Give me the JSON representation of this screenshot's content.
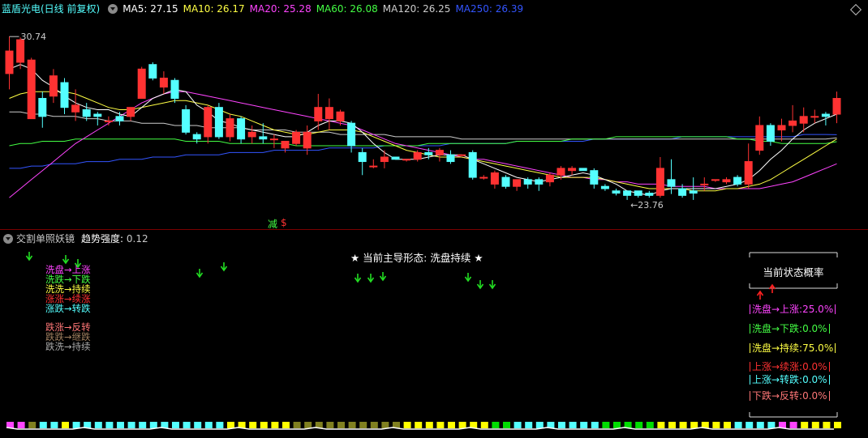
{
  "header": {
    "stock_title": "蓝盾光电(日线 前复权)",
    "ma_items": [
      {
        "label": "MA5: 27.15",
        "color": "#ffffff"
      },
      {
        "label": "MA10: 26.17",
        "color": "#ffff44"
      },
      {
        "label": "MA20: 25.28",
        "color": "#ff44ff"
      },
      {
        "label": "MA60: 26.08",
        "color": "#44ff44"
      },
      {
        "label": "MA120: 26.25",
        "color": "#cccccc"
      },
      {
        "label": "MA250: 26.39",
        "color": "#3355ff"
      }
    ]
  },
  "chart_data": {
    "type": "candlestick",
    "max_label": "30.74",
    "min_label": "23.76",
    "ylim": [
      22.6,
      31.5
    ],
    "candles": [
      [
        29.1,
        30.1,
        28.4,
        30.74
      ],
      [
        29.6,
        30.6,
        29.3,
        30.7
      ],
      [
        27.1,
        29.7,
        27.1,
        29.8
      ],
      [
        28.0,
        27.2,
        26.7,
        28.3
      ],
      [
        28.1,
        29.0,
        27.8,
        29.3
      ],
      [
        28.7,
        27.6,
        27.3,
        28.9
      ],
      [
        27.4,
        27.7,
        27.0,
        28.4
      ],
      [
        27.5,
        27.2,
        27.0,
        27.8
      ],
      [
        27.3,
        27.2,
        26.8,
        27.4
      ],
      [
        27.0,
        27.0,
        26.8,
        27.2
      ],
      [
        27.2,
        27.0,
        26.8,
        27.4
      ],
      [
        27.2,
        27.6,
        27.0,
        27.6
      ],
      [
        28.0,
        29.3,
        28.0,
        29.4
      ],
      [
        29.5,
        28.9,
        28.8,
        29.6
      ],
      [
        28.5,
        28.9,
        28.2,
        29.2
      ],
      [
        28.8,
        28.0,
        27.8,
        28.9
      ],
      [
        27.5,
        26.5,
        26.4,
        27.7
      ],
      [
        26.4,
        26.2,
        26.0,
        26.5
      ],
      [
        26.3,
        27.6,
        26.0,
        27.7
      ],
      [
        27.6,
        26.3,
        26.2,
        27.8
      ],
      [
        26.3,
        27.1,
        26.1,
        27.3
      ],
      [
        27.1,
        26.2,
        26.0,
        27.2
      ],
      [
        26.3,
        26.5,
        26.0,
        26.8
      ],
      [
        26.3,
        26.2,
        26.0,
        26.9
      ],
      [
        26.2,
        26.2,
        25.8,
        26.4
      ],
      [
        25.8,
        26.1,
        25.6,
        26.1
      ],
      [
        26.0,
        26.5,
        25.9,
        26.6
      ],
      [
        25.8,
        26.5,
        25.5,
        26.8
      ],
      [
        27.0,
        27.6,
        26.6,
        28.2
      ],
      [
        27.1,
        27.6,
        26.6,
        28.0
      ],
      [
        27.0,
        27.4,
        26.8,
        27.5
      ],
      [
        26.9,
        25.9,
        25.6,
        27.0
      ],
      [
        25.6,
        25.2,
        24.6,
        25.8
      ],
      [
        25.0,
        25.0,
        24.9,
        25.3
      ],
      [
        25.2,
        25.4,
        24.9,
        25.7
      ],
      [
        25.4,
        25.3,
        25.3,
        25.4
      ],
      [
        25.3,
        25.3,
        25.2,
        25.3
      ],
      [
        25.3,
        25.6,
        25.2,
        25.7
      ],
      [
        25.6,
        25.5,
        25.3,
        25.8
      ],
      [
        25.5,
        25.7,
        25.2,
        25.8
      ],
      [
        25.5,
        25.2,
        25.1,
        25.7
      ],
      [
        25.5,
        25.5,
        25.5,
        25.5
      ],
      [
        25.6,
        24.5,
        24.4,
        25.7
      ],
      [
        24.5,
        24.5,
        24.4,
        24.6
      ],
      [
        24.2,
        24.7,
        24.0,
        24.8
      ],
      [
        24.5,
        24.1,
        24.0,
        24.6
      ],
      [
        24.1,
        24.4,
        23.9,
        24.4
      ],
      [
        24.4,
        24.2,
        24.0,
        24.5
      ],
      [
        24.4,
        24.2,
        23.9,
        24.5
      ],
      [
        24.3,
        24.6,
        24.1,
        24.7
      ],
      [
        24.6,
        24.9,
        24.4,
        25.0
      ],
      [
        24.8,
        24.9,
        24.6,
        25.0
      ],
      [
        24.9,
        24.8,
        24.8,
        24.9
      ],
      [
        24.8,
        24.2,
        24.0,
        24.9
      ],
      [
        24.1,
        24.0,
        23.9,
        24.2
      ],
      [
        23.9,
        23.8,
        23.7,
        24.0
      ],
      [
        23.9,
        23.7,
        23.5,
        23.9
      ],
      [
        23.9,
        23.7,
        23.6,
        23.9
      ],
      [
        23.8,
        23.7,
        23.6,
        23.9
      ],
      [
        23.7,
        24.9,
        23.6,
        25.4
      ],
      [
        24.4,
        24.1,
        23.76,
        25.3
      ],
      [
        24.0,
        23.7,
        23.6,
        24.2
      ],
      [
        23.9,
        23.8,
        23.5,
        24.5
      ],
      [
        24.2,
        24.2,
        23.9,
        24.5
      ],
      [
        24.4,
        24.4,
        24.3,
        24.4
      ],
      [
        24.3,
        24.4,
        24.2,
        24.5
      ],
      [
        24.5,
        24.2,
        24.1,
        24.6
      ],
      [
        24.2,
        25.2,
        24.0,
        26.0
      ],
      [
        25.7,
        26.8,
        25.5,
        27.2
      ],
      [
        26.8,
        26.1,
        25.9,
        26.9
      ],
      [
        26.6,
        26.8,
        26.1,
        27.1
      ],
      [
        26.8,
        27.0,
        26.5,
        27.7
      ],
      [
        26.9,
        27.2,
        26.5,
        27.6
      ],
      [
        27.2,
        27.2,
        26.9,
        27.5
      ],
      [
        27.3,
        27.2,
        26.8,
        27.4
      ],
      [
        27.3,
        28.0,
        26.9,
        28.3
      ]
    ],
    "ma_lines": {
      "MA5": [
        29.3,
        29.5,
        29.3,
        28.8,
        28.5,
        28.1,
        27.8,
        27.6,
        27.5,
        27.5,
        27.3,
        27.2,
        27.6,
        28.0,
        28.2,
        28.4,
        28.3,
        27.7,
        27.4,
        27.0,
        26.9,
        26.7,
        26.6,
        26.5,
        26.4,
        26.3,
        26.3,
        26.5,
        26.8,
        27.0,
        27.0,
        26.9,
        26.5,
        26.0,
        25.6,
        25.3,
        25.3,
        25.3,
        25.4,
        25.5,
        25.5,
        25.5,
        25.3,
        25.1,
        24.9,
        24.7,
        24.5,
        24.4,
        24.3,
        24.4,
        24.5,
        24.6,
        24.7,
        24.6,
        24.4,
        24.2,
        23.9,
        23.8,
        23.7,
        23.9,
        24.0,
        24.0,
        24.0,
        24.0,
        24.0,
        24.1,
        24.2,
        24.4,
        24.8,
        25.3,
        25.7,
        26.2,
        26.6,
        26.9,
        27.1,
        27.3
      ],
      "MA10": [
        28.0,
        28.2,
        28.3,
        28.3,
        28.3,
        28.3,
        28.2,
        28.0,
        27.8,
        27.6,
        27.5,
        27.5,
        27.6,
        27.7,
        27.8,
        27.9,
        27.9,
        27.8,
        27.7,
        27.5,
        27.3,
        27.2,
        27.0,
        26.8,
        26.6,
        26.5,
        26.4,
        26.4,
        26.5,
        26.6,
        26.6,
        26.6,
        26.5,
        26.3,
        26.1,
        25.9,
        25.7,
        25.6,
        25.5,
        25.4,
        25.4,
        25.4,
        25.3,
        25.2,
        25.1,
        25.0,
        24.9,
        24.8,
        24.7,
        24.6,
        24.5,
        24.5,
        24.5,
        24.5,
        24.4,
        24.3,
        24.2,
        24.1,
        24.0,
        24.0,
        24.0,
        24.0,
        23.9,
        23.9,
        23.9,
        24.0,
        24.0,
        24.1,
        24.2,
        24.4,
        24.7,
        25.0,
        25.3,
        25.6,
        25.9,
        26.2
      ],
      "MA20": [
        23.6,
        24.0,
        24.4,
        24.8,
        25.2,
        25.6,
        26.0,
        26.3,
        26.6,
        26.9,
        27.2,
        27.5,
        27.8,
        28.0,
        28.2,
        28.3,
        28.3,
        28.2,
        28.1,
        28.0,
        27.9,
        27.8,
        27.7,
        27.6,
        27.5,
        27.4,
        27.3,
        27.2,
        27.1,
        27.0,
        26.9,
        26.8,
        26.6,
        26.4,
        26.2,
        26.0,
        25.9,
        25.8,
        25.7,
        25.6,
        25.5,
        25.4,
        25.3,
        25.3,
        25.2,
        25.1,
        25.0,
        24.9,
        24.8,
        24.7,
        24.6,
        24.5,
        24.5,
        24.4,
        24.4,
        24.3,
        24.3,
        24.2,
        24.2,
        24.2,
        24.1,
        24.1,
        24.1,
        24.1,
        24.0,
        24.0,
        24.0,
        24.0,
        24.0,
        24.1,
        24.2,
        24.3,
        24.5,
        24.7,
        24.9,
        25.1
      ],
      "MA60": [
        25.9,
        26.0,
        26.0,
        26.1,
        26.1,
        26.1,
        26.2,
        26.2,
        26.2,
        26.2,
        26.2,
        26.2,
        26.2,
        26.2,
        26.2,
        26.2,
        26.1,
        26.1,
        26.1,
        26.1,
        26.0,
        26.0,
        26.0,
        26.0,
        26.0,
        26.0,
        25.9,
        25.9,
        25.9,
        25.9,
        25.9,
        25.9,
        25.9,
        25.9,
        25.9,
        25.9,
        25.9,
        25.9,
        26.0,
        26.0,
        26.0,
        26.0,
        26.0,
        26.0,
        26.0,
        26.0,
        26.1,
        26.1,
        26.1,
        26.1,
        26.1,
        26.2,
        26.2,
        26.2,
        26.2,
        26.3,
        26.3,
        26.3,
        26.3,
        26.3,
        26.3,
        26.3,
        26.3,
        26.3,
        26.3,
        26.3,
        26.2,
        26.2,
        26.1,
        26.1,
        26.0,
        26.0,
        26.0,
        26.0,
        26.0,
        26.08
      ],
      "MA120": [
        27.4,
        27.4,
        27.3,
        27.3,
        27.2,
        27.2,
        27.2,
        27.1,
        27.1,
        27.0,
        27.0,
        27.0,
        26.9,
        26.9,
        26.9,
        26.8,
        26.8,
        26.8,
        26.7,
        26.7,
        26.7,
        26.7,
        26.6,
        26.6,
        26.6,
        26.6,
        26.5,
        26.5,
        26.5,
        26.5,
        26.4,
        26.4,
        26.4,
        26.4,
        26.4,
        26.3,
        26.3,
        26.3,
        26.3,
        26.3,
        26.3,
        26.2,
        26.2,
        26.2,
        26.2,
        26.2,
        26.2,
        26.2,
        26.2,
        26.2,
        26.2,
        26.2,
        26.2,
        26.2,
        26.2,
        26.2,
        26.2,
        26.2,
        26.2,
        26.2,
        26.2,
        26.2,
        26.2,
        26.2,
        26.2,
        26.2,
        26.2,
        26.2,
        26.2,
        26.2,
        26.2,
        26.2,
        26.2,
        26.2,
        26.2,
        26.25
      ],
      "MA250": [
        24.9,
        24.9,
        25.0,
        25.0,
        25.1,
        25.1,
        25.1,
        25.2,
        25.2,
        25.2,
        25.3,
        25.3,
        25.3,
        25.4,
        25.4,
        25.4,
        25.5,
        25.5,
        25.5,
        25.5,
        25.6,
        25.6,
        25.6,
        25.6,
        25.7,
        25.7,
        25.7,
        25.7,
        25.7,
        25.8,
        25.8,
        25.8,
        25.8,
        25.8,
        25.9,
        25.9,
        25.9,
        25.9,
        25.9,
        25.9,
        26.0,
        26.0,
        26.0,
        26.0,
        26.0,
        26.0,
        26.1,
        26.1,
        26.1,
        26.1,
        26.1,
        26.1,
        26.1,
        26.2,
        26.2,
        26.2,
        26.2,
        26.2,
        26.2,
        26.2,
        26.2,
        26.3,
        26.3,
        26.3,
        26.3,
        26.3,
        26.3,
        26.3,
        26.3,
        26.3,
        26.3,
        26.3,
        26.4,
        26.4,
        26.4,
        26.39
      ]
    },
    "colors": {
      "up": "#ff3232",
      "down": "#54ffff",
      "MA5": "#ffffff",
      "MA10": "#ffff44",
      "MA20": "#ff44ff",
      "MA60": "#44ff44",
      "MA120": "#cccccc",
      "MA250": "#3355ff"
    }
  },
  "signal_marks": {
    "jian": "减",
    "s": "$"
  },
  "indicator": {
    "name": "交割单照妖镜",
    "strength_label": "趋势强度:",
    "strength_value": "0.12",
    "center_title": "★ 当前主导形态: 洗盘持续 ★",
    "legend": [
      {
        "text": "洗盘→上涨",
        "color": "#ff44ff"
      },
      {
        "text": "洗跌→下跌",
        "color": "#44ff44"
      },
      {
        "text": "洗洗→持续",
        "color": "#ffff44"
      },
      {
        "text": "涨涨→续涨",
        "color": "#ff3232"
      },
      {
        "text": "涨跌→转跌",
        "color": "#54ffff"
      },
      {
        "text": "跌涨→反转",
        "color": "#ff7777"
      },
      {
        "text": "跌跌→继跌",
        "color": "#a08060"
      },
      {
        "text": "跌洗→持续",
        "color": "#aaaaaa"
      }
    ],
    "panel_title": "当前状态概率",
    "probs": [
      {
        "text": "洗盘→上涨:25.0%",
        "color": "#ff44ff"
      },
      {
        "text": "洗盘→下跌:0.0%",
        "color": "#44ff44"
      },
      {
        "text": "洗盘→持续:75.0%",
        "color": "#ffff44"
      },
      {
        "text": "上涨→续涨:0.0%",
        "color": "#ff3232"
      },
      {
        "text": "上涨→转跌:0.0%",
        "color": "#54ffff"
      },
      {
        "text": "下跌→反转:0.0%",
        "color": "#ff7777"
      }
    ],
    "arrow_down_color": "#22dd22",
    "arrow_up_color": "#ff2020",
    "bottom_bar_colors": [
      "#54ffff",
      "#ffff00",
      "#808020",
      "#00dd00",
      "#ff44ff"
    ]
  }
}
